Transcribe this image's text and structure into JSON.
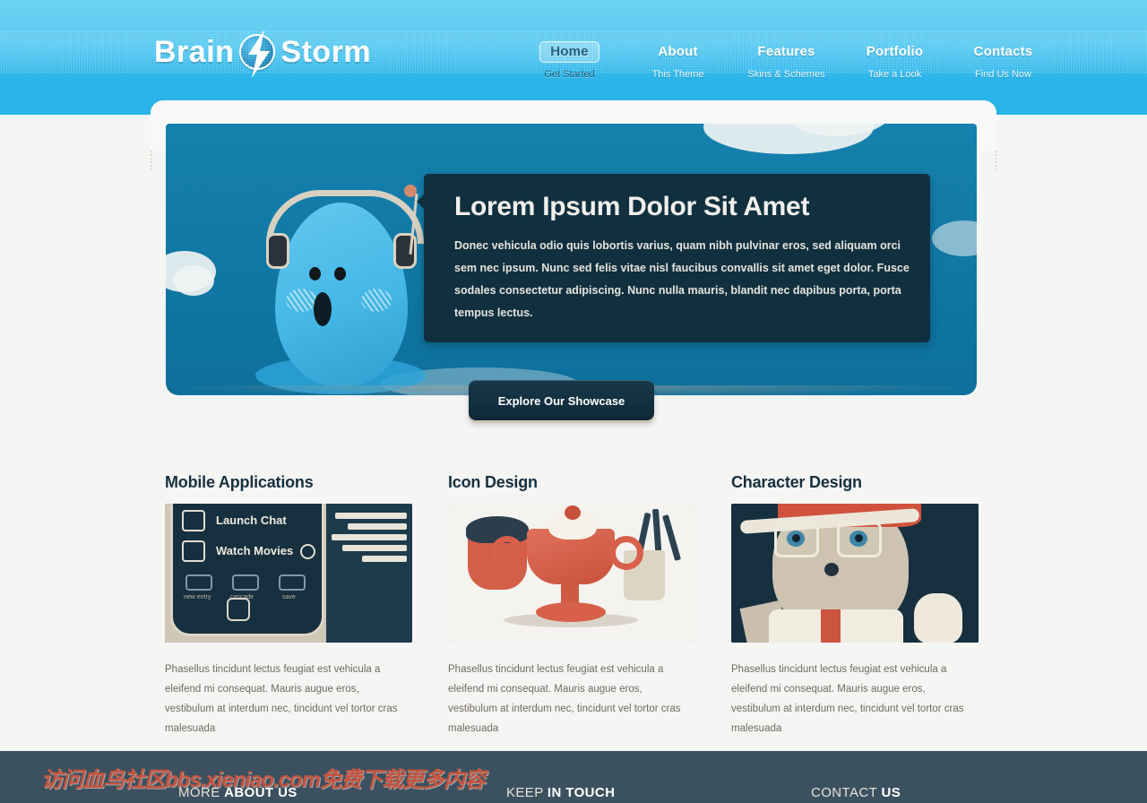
{
  "header": {
    "logo": {
      "first": "Brain",
      "second": "Storm",
      "icon": "lightning-bolt-icon"
    },
    "nav": [
      {
        "label": "Home",
        "sub": "Get Started",
        "active": true
      },
      {
        "label": "About",
        "sub": "This Theme",
        "active": false
      },
      {
        "label": "Features",
        "sub": "Skins & Schemes",
        "active": false
      },
      {
        "label": "Portfolio",
        "sub": "Take a Look",
        "active": false
      },
      {
        "label": "Contacts",
        "sub": "Find Us Now",
        "active": false
      }
    ]
  },
  "hero": {
    "title": "Lorem Ipsum Dolor Sit Amet",
    "text": "Donec vehicula odio quis lobortis varius, quam nibh pulvinar eros, sed aliquam orci sem nec ipsum. Nunc sed felis vitae nisl faucibus convallis sit amet eget dolor. Fusce sodales consectetur adipiscing. Nunc nulla mauris, blandit nec dapibus porta, porta tempus lectus.",
    "cta_label": "Explore Our Showcase",
    "illustration": "blue-blob-character-with-headphones"
  },
  "columns": [
    {
      "title": "Mobile Applications",
      "image": "mobile-phone-ui-mockup",
      "text": "Phasellus tincidunt lectus feugiat est vehicula a eleifend mi consequat. Mauris augue eros, vestibulum at interdum nec, tincidunt vel tortor cras malesuada",
      "phone_ui": {
        "row1": "Launch Chat",
        "row2": "Watch Movies",
        "icons": [
          "new entry",
          "cascade",
          "save"
        ]
      }
    },
    {
      "title": "Icon Design",
      "image": "dessert-sundae-illustration",
      "text": "Phasellus tincidunt lectus feugiat est vehicula a eleifend mi consequat. Mauris augue eros, vestibulum at interdum nec, tincidunt vel tortor cras malesuada"
    },
    {
      "title": "Character Design",
      "image": "cartoon-detective-character",
      "text": "Phasellus tincidunt lectus feugiat est vehicula a eleifend mi consequat. Mauris augue eros, vestibulum at interdum nec, tincidunt vel tortor cras malesuada"
    }
  ],
  "footer": {
    "watermark": "访问血鸟社区bbs.xieniao.com免费下载更多内容",
    "headings": [
      {
        "light": "MORE ",
        "bold": "ABOUT US"
      },
      {
        "light": "KEEP ",
        "bold": "IN TOUCH"
      },
      {
        "light": "CONTACT ",
        "bold": "US"
      }
    ]
  },
  "colors": {
    "header_top": "#6cd2f3",
    "header_bottom": "#29b3e8",
    "hero_bg": "#0f7aa8",
    "panel": "#10303f",
    "footer": "#3c515f",
    "accent_red": "#c6543f",
    "page_bg": "#f5f5f4"
  }
}
